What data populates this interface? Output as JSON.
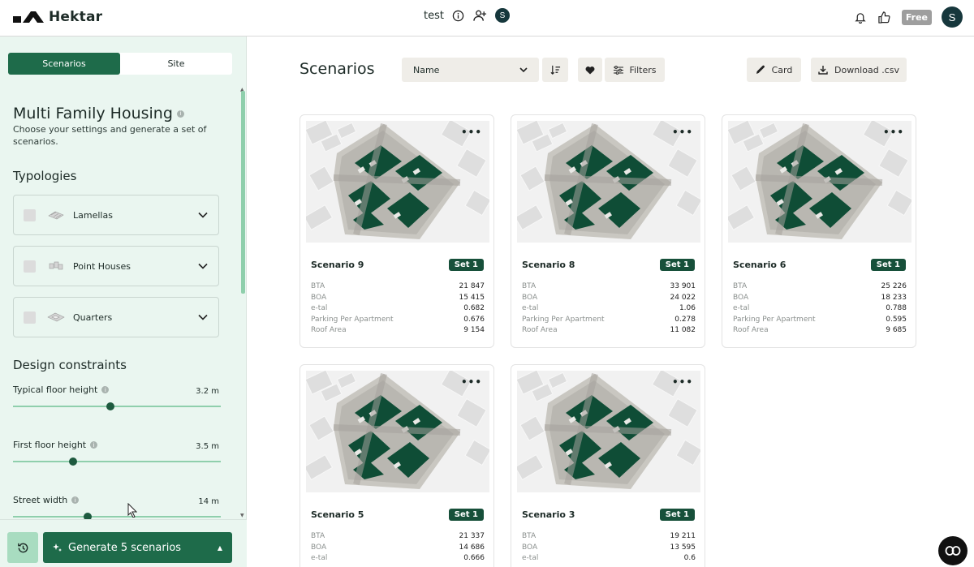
{
  "app": {
    "name": "Hektar",
    "project": "test",
    "plan_badge": "Free",
    "user_initial": "S",
    "collab_initial": "S"
  },
  "sidebar": {
    "tabs": [
      {
        "label": "Scenarios",
        "active": true
      },
      {
        "label": "Site",
        "active": false
      }
    ],
    "title": "Multi Family Housing",
    "subtitle": "Choose your settings and generate a set of scenarios.",
    "typologies_heading": "Typologies",
    "typologies": [
      {
        "label": "Lamellas",
        "checked": false
      },
      {
        "label": "Point Houses",
        "checked": false
      },
      {
        "label": "Quarters",
        "checked": false
      }
    ],
    "constraints_heading": "Design constraints",
    "sliders": [
      {
        "label": "Typical floor height",
        "value": "3.2 m",
        "fraction": 0.47
      },
      {
        "label": "First floor height",
        "value": "3.5 m",
        "fraction": 0.29
      },
      {
        "label": "Street width",
        "value": "14 m",
        "fraction": 0.36
      }
    ],
    "generate_label": "Generate 5 scenarios"
  },
  "main": {
    "title": "Scenarios",
    "sort_select": "Name",
    "filters_label": "Filters",
    "card_label": "Card",
    "download_label": "Download .csv",
    "stat_keys": [
      "BTA",
      "BOA",
      "e-tal",
      "Parking Per Apartment",
      "Roof Area"
    ],
    "cards": [
      {
        "name": "Scenario 9",
        "set": "Set 1",
        "values": [
          "21 847",
          "15 415",
          "0.682",
          "0.676",
          "9 154"
        ]
      },
      {
        "name": "Scenario 8",
        "set": "Set 1",
        "values": [
          "33 901",
          "24 022",
          "1.06",
          "0.278",
          "11 082"
        ]
      },
      {
        "name": "Scenario 6",
        "set": "Set 1",
        "values": [
          "25 226",
          "18 233",
          "0.788",
          "0.595",
          "9 685"
        ]
      },
      {
        "name": "Scenario 5",
        "set": "Set 1",
        "values": [
          "21 337",
          "14 686",
          "0.666",
          "",
          ""
        ]
      },
      {
        "name": "Scenario 3",
        "set": "Set 1",
        "values": [
          "19 211",
          "13 595",
          "0.6",
          "",
          ""
        ]
      }
    ]
  },
  "colors": {
    "accent": "#1e6b4a",
    "sidebar_bg": "#eaf6f0",
    "building": "#0f4d36"
  }
}
